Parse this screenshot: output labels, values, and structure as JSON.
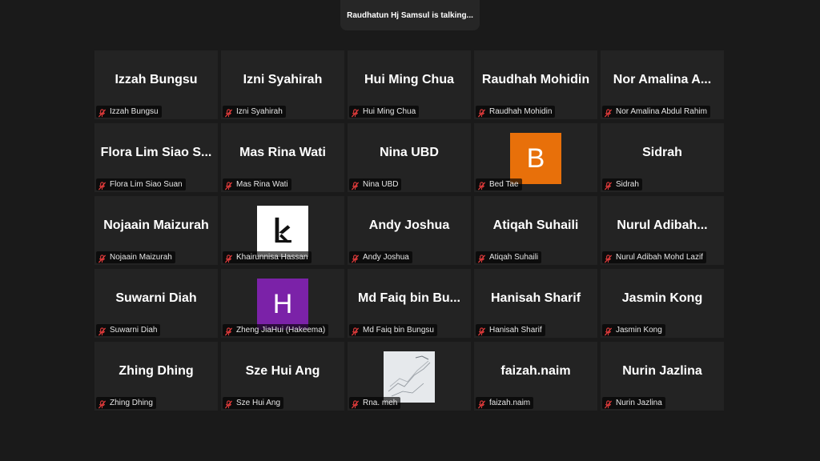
{
  "talking_indicator": "Raudhatun Hj Samsul is talking...",
  "colors": {
    "background": "#1a1a1a",
    "tile": "#232323",
    "muted_mic": "#e03b3b"
  },
  "participants": [
    {
      "display": "Izzah Bungsu",
      "label": "Izzah Bungsu",
      "avatar": "none",
      "muted": true,
      "mic_icon": "mic-muted-icon"
    },
    {
      "display": "Izni Syahirah",
      "label": "Izni Syahirah",
      "avatar": "none",
      "muted": true,
      "mic_icon": "mic-muted-icon"
    },
    {
      "display": "Hui Ming Chua",
      "label": "Hui Ming Chua",
      "avatar": "none",
      "muted": true,
      "mic_icon": "mic-muted-icon"
    },
    {
      "display": "Raudhah Mohidin",
      "label": "Raudhah Mohidin",
      "avatar": "none",
      "muted": true,
      "mic_icon": "mic-muted-icon"
    },
    {
      "display": "Nor Amalina A...",
      "label": "Nor Amalina Abdul Rahim",
      "avatar": "none",
      "muted": true,
      "mic_icon": "mic-muted-icon"
    },
    {
      "display": "Flora Lim Siao S...",
      "label": "Flora Lim Siao Suan",
      "avatar": "none",
      "muted": true,
      "mic_icon": "mic-muted-icon"
    },
    {
      "display": "Mas Rina Wati",
      "label": "Mas Rina Wati",
      "avatar": "none",
      "muted": true,
      "mic_icon": "mic-muted-icon"
    },
    {
      "display": "Nina UBD",
      "label": "Nina UBD",
      "avatar": "none",
      "muted": true,
      "mic_icon": "mic-muted-icon"
    },
    {
      "display": "",
      "label": "Bed Tae",
      "avatar": "letter",
      "letter": "B",
      "avatar_color": "#e8700a",
      "muted": true,
      "mic_icon": "mic-muted-icon"
    },
    {
      "display": "Sidrah",
      "label": "Sidrah",
      "avatar": "none",
      "muted": true,
      "mic_icon": "mic-muted-icon"
    },
    {
      "display": "Nojaain Maizurah",
      "label": "Nojaain Maizurah",
      "avatar": "none",
      "muted": true,
      "mic_icon": "mic-muted-icon"
    },
    {
      "display": "",
      "label": "Khairunnisa Hassan",
      "avatar": "logo",
      "muted": true,
      "mic_icon": "mic-muted-icon"
    },
    {
      "display": "Andy Joshua",
      "label": "Andy Joshua",
      "avatar": "none",
      "muted": true,
      "mic_icon": "mic-muted-icon"
    },
    {
      "display": "Atiqah Suhaili",
      "label": "Atiqah Suhaili",
      "avatar": "none",
      "muted": true,
      "mic_icon": "mic-muted-icon"
    },
    {
      "display": "Nurul  Adibah...",
      "label": "Nurul Adibah Mohd Lazif",
      "avatar": "none",
      "muted": true,
      "mic_icon": "mic-muted-icon"
    },
    {
      "display": "Suwarni Diah",
      "label": "Suwarni Diah",
      "avatar": "none",
      "muted": true,
      "mic_icon": "mic-muted-icon"
    },
    {
      "display": "",
      "label": "Zheng JiaHui (Hakeema)",
      "avatar": "letter",
      "letter": "H",
      "avatar_color": "#7b22a8",
      "muted": true,
      "mic_icon": "mic-muted-icon"
    },
    {
      "display": "Md Faiq bin Bu...",
      "label": "Md Faiq bin Bungsu",
      "avatar": "none",
      "muted": true,
      "mic_icon": "mic-muted-icon"
    },
    {
      "display": "Hanisah Sharif",
      "label": "Hanisah Sharif",
      "avatar": "none",
      "muted": true,
      "mic_icon": "mic-muted-icon"
    },
    {
      "display": "Jasmin Kong",
      "label": "Jasmin Kong",
      "avatar": "none",
      "muted": true,
      "mic_icon": "mic-muted-icon"
    },
    {
      "display": "Zhing Dhing",
      "label": "Zhing Dhing",
      "avatar": "none",
      "muted": true,
      "mic_icon": "mic-muted-icon"
    },
    {
      "display": "Sze Hui Ang",
      "label": "Sze Hui Ang",
      "avatar": "none",
      "muted": true,
      "mic_icon": "mic-muted-icon"
    },
    {
      "display": "",
      "label": "Rna. meh",
      "avatar": "photo",
      "muted": true,
      "mic_icon": "mic-muted-icon"
    },
    {
      "display": "faizah.naim",
      "label": "faizah.naim",
      "avatar": "none",
      "muted": true,
      "mic_icon": "mic-muted-icon"
    },
    {
      "display": "Nurin Jazlina",
      "label": "Nurin Jazlina",
      "avatar": "none",
      "muted": true,
      "mic_icon": "mic-muted-icon"
    }
  ]
}
